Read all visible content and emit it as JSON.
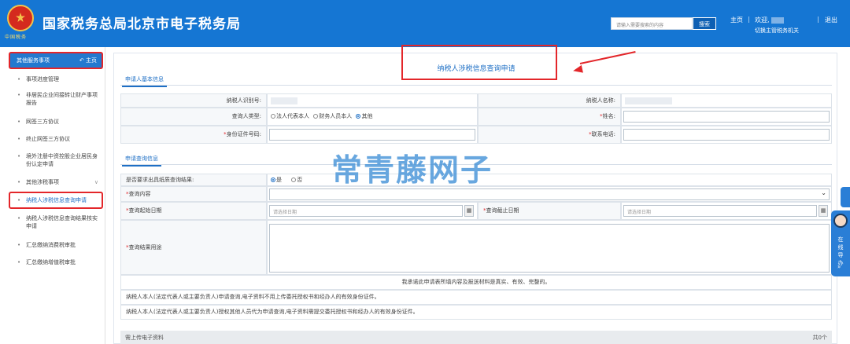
{
  "header": {
    "emblem_caption": "中国税务",
    "title": "国家税务总局北京市电子税务局",
    "search_placeholder": "请输入需要搜索的内容",
    "search_button": "搜索",
    "home_link": "主页",
    "welcome": "欢迎,",
    "switch_agency": "切换主管税务机关",
    "logout": "退出",
    "separator": "|"
  },
  "sidebar": {
    "title": "其他服务事项",
    "home": "主页",
    "items": [
      {
        "label": "事项进度管理"
      },
      {
        "label": "非居民企业间接转让财产事项报告"
      },
      {
        "label": "网签三方协议"
      },
      {
        "label": "终止网签三方协议"
      },
      {
        "label": "境外注册中资控股企业居民身份认定申请"
      },
      {
        "label": "其他涉税事项"
      },
      {
        "label": "纳税人涉税信息查询申请"
      },
      {
        "label": "纳税人涉税信息查询结果核实申请"
      },
      {
        "label": "汇总缴纳消费税审批"
      },
      {
        "label": "汇总缴纳增值税审批"
      }
    ]
  },
  "main": {
    "title": "纳税人涉税信息查询申请",
    "basic_tab": "申请人基本信息",
    "taxpayer_id_label": "纳税人识别号:",
    "taxpayer_name_label": "纳税人名称:",
    "querier_type_label": "查询人类型:",
    "querier_type_options": [
      "法人代表本人",
      "财务人员本人",
      "其他"
    ],
    "querier_type_selected": "其他",
    "name_label": "姓名:",
    "id_no_label": "身份证件号码:",
    "phone_label": "联系电话:",
    "request_tab": "申请查询信息",
    "paper_result_label": "是否要求出具纸质查询结果:",
    "paper_result_options": [
      "是",
      "否"
    ],
    "paper_result_selected": "是",
    "content_label": "查询内容",
    "start_date_label": "查询起始日期",
    "start_date_placeholder": "请选择日期",
    "end_date_label": "查询截止日期",
    "end_date_placeholder": "请选择日期",
    "purpose_label": "查询结果用途",
    "declaration": "我承诺此申请表所填内容及报送材料是真实、有效、完整的。",
    "note1": "纳税人本人(法定代表人或主要负责人)申请查询,电子资料不用上传委托授权书和经办人的有效身份证件。",
    "note2": "纳税人本人(法定代表人或主要负责人)授权其他人员代为申请查询,电子资料需提交委托授权书和经办人的有效身份证件。",
    "upload_title": "需上传电子资料",
    "upload_count": "共0个",
    "req_mark": "*"
  },
  "watermark": "常青藤网子",
  "float_widget": {
    "text": "在线导办",
    "arrow": "»"
  },
  "colors": {
    "header_blue": "#1576d3",
    "accent_blue": "#1e6fc5",
    "annotation_red": "#e3262a"
  }
}
